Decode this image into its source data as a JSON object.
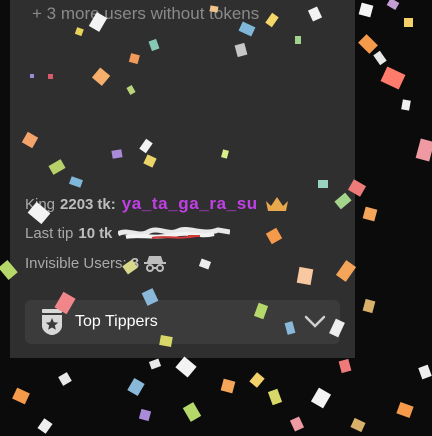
{
  "panel": {
    "more_users_text": "+ 3 more users without tokens"
  },
  "stats": {
    "king_label": "King",
    "king_amount": "2203",
    "king_unit": "tk:",
    "king_name": "ya_ta_ga_ra_su",
    "last_tip_label": "Last tip",
    "last_tip_amount": "10",
    "last_tip_unit": "tk",
    "invisible_label": "Invisible Users:",
    "invisible_count": "3"
  },
  "dropdown": {
    "label": "Top Tippers"
  },
  "icons": {
    "crown": "crown-icon",
    "spy": "spy-icon",
    "star_badge": "star-badge-icon",
    "chevron": "chevron-down-icon"
  },
  "colors": {
    "king_name": "#c23fe6",
    "crown": "#e7a94b",
    "panel_bg": "#2f2f2f",
    "page_bg": "#0b0b0b"
  }
}
